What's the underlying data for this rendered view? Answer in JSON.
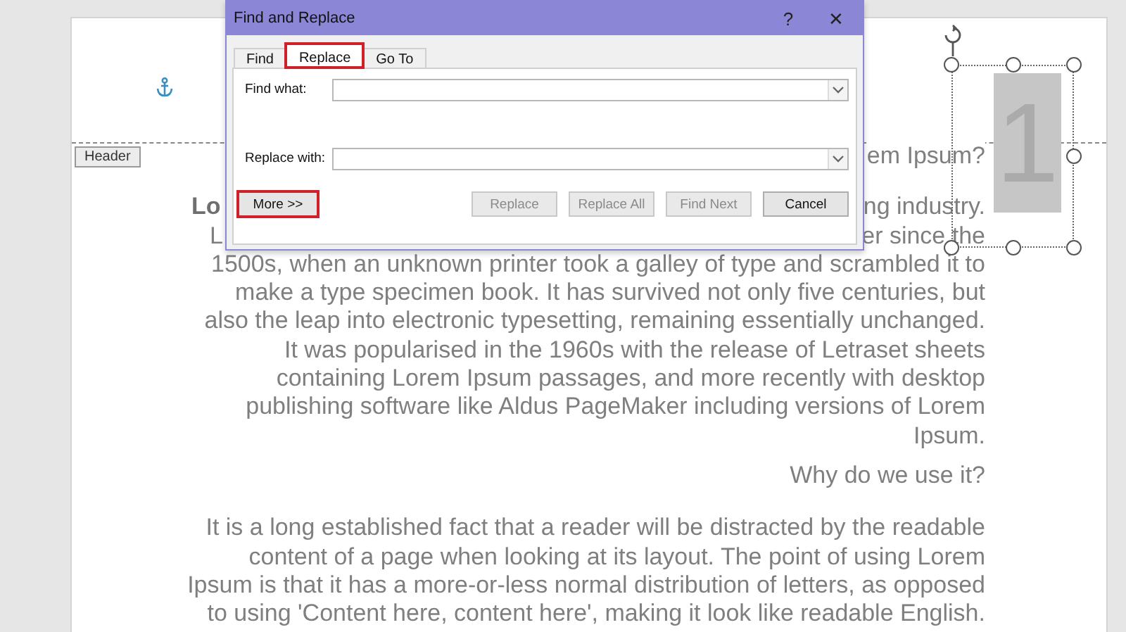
{
  "document": {
    "header_label": "Header",
    "heading_fragment": "em Ipsum?",
    "partial_lines": [
      {
        "left": "Lo",
        "left_bold": true,
        "right": "ng industry."
      },
      {
        "left": "L",
        "left_bold": false,
        "right": "er since the"
      }
    ],
    "paragraphs": [
      [
        "1500s, when an unknown printer took a galley of type and scrambled it to",
        "make a type specimen book. It has survived not only five centuries, but",
        "also the leap into electronic typesetting, remaining essentially unchanged.",
        "It was popularised in the 1960s with the release of Letraset sheets",
        "containing Lorem Ipsum passages, and more recently with desktop",
        "publishing software like Aldus PageMaker including versions of Lorem",
        "Ipsum."
      ],
      [
        "Why do we use it?"
      ],
      [
        "It is a long established fact that a reader will be distracted by the readable",
        "content of a page when looking at its layout. The point of using Lorem",
        "Ipsum is that it has a more-or-less normal distribution of letters, as opposed",
        "to using 'Content here, content here', making it look like readable English."
      ]
    ],
    "text_box": {
      "text": "1",
      "selected": true
    }
  },
  "dialog": {
    "title": "Find and Replace",
    "help": "?",
    "close": "✕",
    "tabs": [
      {
        "label": "Find",
        "selected": false,
        "highlighted": false
      },
      {
        "label": "Replace",
        "selected": true,
        "highlighted": true
      },
      {
        "label": "Go To",
        "selected": false,
        "highlighted": false
      }
    ],
    "fields": [
      {
        "label": "Find what:"
      },
      {
        "label": "Replace with:"
      }
    ],
    "more_button": {
      "label": "More >>",
      "highlighted": true
    },
    "buttons": [
      {
        "label": "Replace",
        "disabled": true
      },
      {
        "label": "Replace All",
        "disabled": true
      },
      {
        "label": "Find Next",
        "disabled": true
      },
      {
        "label": "Cancel",
        "disabled": false
      }
    ]
  }
}
